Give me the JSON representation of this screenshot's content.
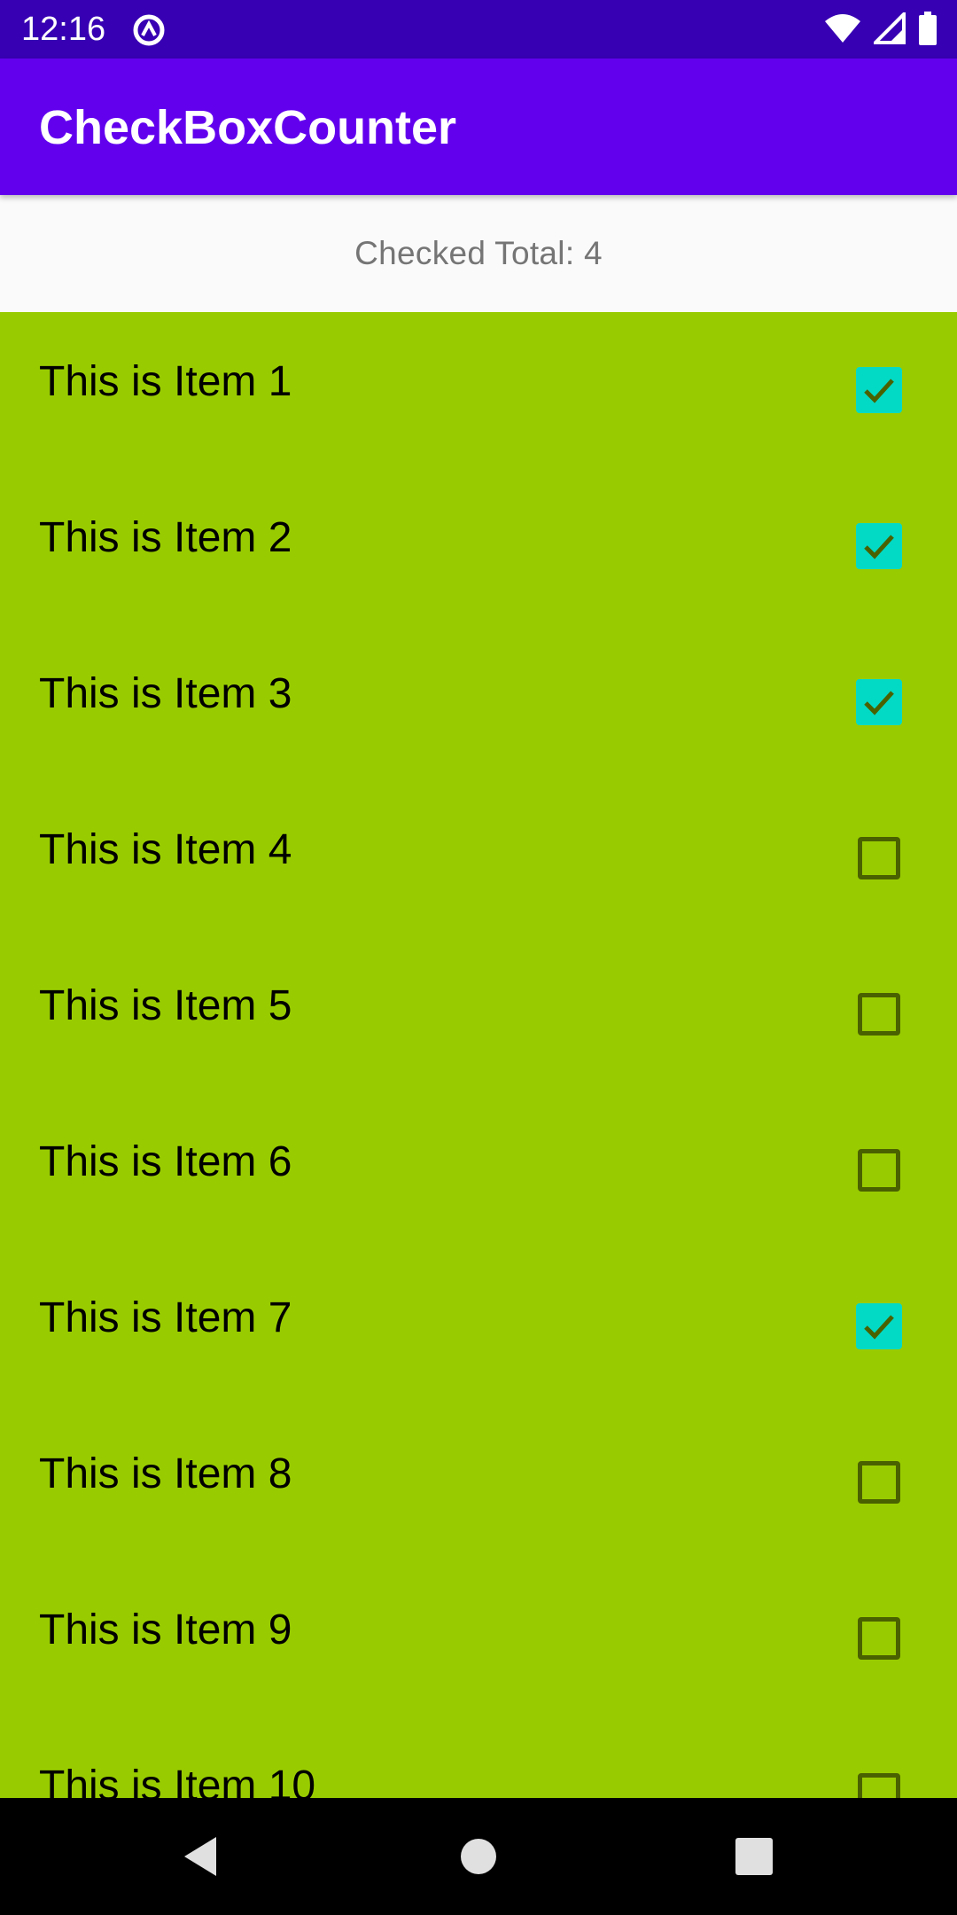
{
  "status_bar": {
    "time": "12:16",
    "icons": [
      "app-notification-icon",
      "wifi-icon",
      "signal-icon",
      "battery-icon"
    ]
  },
  "app_bar": {
    "title": "CheckBoxCounter"
  },
  "counter": {
    "text": "Checked Total: 4"
  },
  "list": {
    "items": [
      {
        "label": "This is Item 1",
        "checked": true
      },
      {
        "label": "This is Item 2",
        "checked": true
      },
      {
        "label": "This is Item 3",
        "checked": true
      },
      {
        "label": "This is Item 4",
        "checked": false
      },
      {
        "label": "This is Item 5",
        "checked": false
      },
      {
        "label": "This is Item 6",
        "checked": false
      },
      {
        "label": "This is Item 7",
        "checked": true
      },
      {
        "label": "This is Item 8",
        "checked": false
      },
      {
        "label": "This is Item 9",
        "checked": false
      },
      {
        "label": "This is Item 10",
        "checked": false
      }
    ]
  },
  "nav_bar": {
    "buttons": [
      "back-icon",
      "home-icon",
      "recents-icon"
    ]
  },
  "colors": {
    "status_bar": "#3700b3",
    "app_bar": "#6200ee",
    "list_background": "#99cc00",
    "checkbox_checked": "#03dac5",
    "checkbox_unchecked_border": "#4a6100"
  }
}
